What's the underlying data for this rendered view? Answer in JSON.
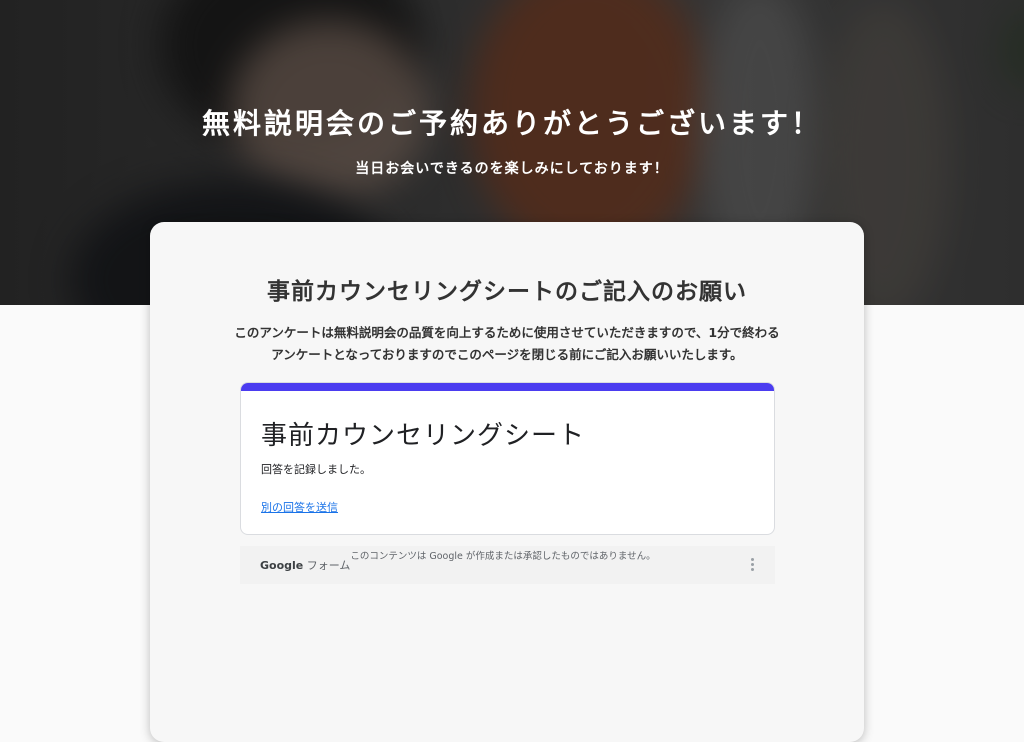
{
  "hero": {
    "title": "無料説明会のご予約ありがとうございます！",
    "subtitle": "当日お会いできるのを楽しみにしております！"
  },
  "card": {
    "title": "事前カウンセリングシートのご記入のお願い",
    "description_line1": "このアンケートは無料説明会の品質を向上するために使用させていただきますので、1分で終わる",
    "description_line2": "アンケートとなっておりますのでこのページを閉じる前にご記入お願いいたします。"
  },
  "form": {
    "title": "事前カウンセリングシート",
    "message": "回答を記録しました。",
    "link_label": "別の回答を送信",
    "accent_color": "#4b3cf0"
  },
  "footer": {
    "brand": "Google",
    "brand_suffix": "フォーム",
    "disclaimer": "このコンテンツは Google が作成または承認したものではありません。",
    "more_icon": "more-vert-icon"
  }
}
